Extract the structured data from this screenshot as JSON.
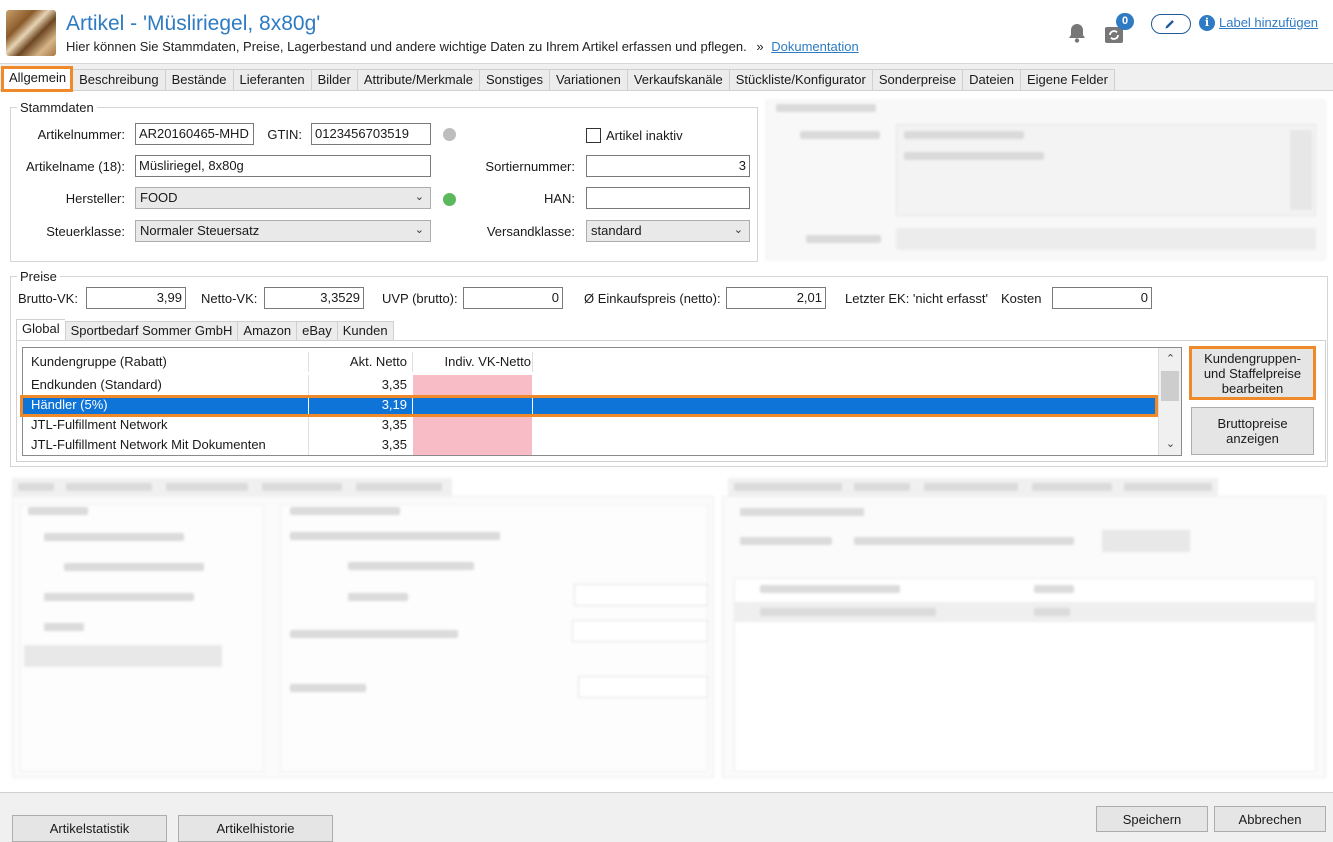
{
  "header": {
    "title": "Artikel - 'Müsliriegel, 8x80g'",
    "subtitle": "Hier können Sie Stammdaten, Preise, Lagerbestand und andere wichtige Daten zu Ihrem Artikel erfassen und pflegen.",
    "subtitle_sep": "»",
    "doc_link": "Dokumentation",
    "notification_count": "0",
    "label_link": "Label hinzufügen",
    "info_glyph": "i"
  },
  "tabs": [
    "Allgemein",
    "Beschreibung",
    "Bestände",
    "Lieferanten",
    "Bilder",
    "Attribute/Merkmale",
    "Sonstiges",
    "Variationen",
    "Verkaufskanäle",
    "Stückliste/Konfigurator",
    "Sonderpreise",
    "Dateien",
    "Eigene Felder"
  ],
  "stammdaten": {
    "legend": "Stammdaten",
    "artikelnummer_label": "Artikelnummer:",
    "artikelnummer": "AR20160465-MHD",
    "gtin_label": "GTIN:",
    "gtin": "0123456703519",
    "artikel_inaktiv_label": "Artikel inaktiv",
    "artikelname_label": "Artikelname (18):",
    "artikelname": "Müsliriegel, 8x80g",
    "sortiernummer_label": "Sortiernummer:",
    "sortiernummer": "3",
    "hersteller_label": "Hersteller:",
    "hersteller": "FOOD",
    "han_label": "HAN:",
    "han": "",
    "steuerklasse_label": "Steuerklasse:",
    "steuerklasse": "Normaler Steuersatz",
    "versandklasse_label": "Versandklasse:",
    "versandklasse": "standard"
  },
  "preise": {
    "legend": "Preise",
    "brutto_vk_label": "Brutto-VK:",
    "brutto_vk": "3,99",
    "netto_vk_label": "Netto-VK:",
    "netto_vk": "3,3529",
    "uvp_label": "UVP (brutto):",
    "uvp": "0",
    "einkaufspreis_label": "Ø Einkaufspreis (netto):",
    "einkaufspreis": "2,01",
    "letzter_ek": "Letzter EK: 'nicht erfasst'",
    "kosten_label": "Kosten",
    "kosten": "0",
    "subtabs": [
      "Global",
      "Sportbedarf Sommer GmbH",
      "Amazon",
      "eBay",
      "Kunden"
    ],
    "grid_headers": [
      "Kundengruppe (Rabatt)",
      "Akt. Netto",
      "Indiv. VK-Netto"
    ],
    "rows": [
      {
        "gruppe": "Endkunden (Standard)",
        "netto": "3,35",
        "indiv": ""
      },
      {
        "gruppe": "Händler (5%)",
        "netto": "3,19",
        "indiv": ""
      },
      {
        "gruppe": "JTL-Fulfillment Network",
        "netto": "3,35",
        "indiv": ""
      },
      {
        "gruppe": "JTL-Fulfillment Network Mit Dokumenten",
        "netto": "3,35",
        "indiv": ""
      }
    ],
    "kundengruppen_button": "Kundengruppen-\nund Staffelpreise\nbearbeiten",
    "bruttopreise_button": "Bruttopreise\nanzeigen"
  },
  "footer": {
    "artikelstatistik": "Artikelstatistik",
    "artikelhistorie": "Artikelhistorie",
    "speichern": "Speichern",
    "abbrechen": "Abbrechen"
  },
  "colors": {
    "accent": "#2e7bc3",
    "highlight": "#f0892a",
    "selection": "#0f74d7",
    "pink_cell": "#f8bcc6"
  }
}
